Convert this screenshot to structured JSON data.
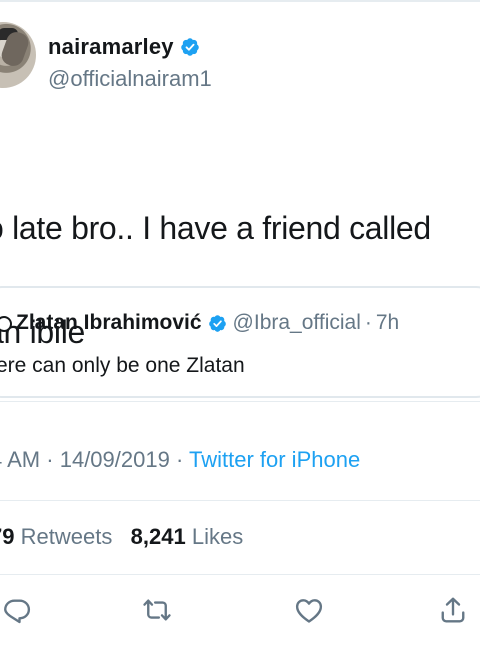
{
  "tweet": {
    "author": {
      "name": "nairamarley",
      "handle": "@officialnairam1"
    },
    "text_line1": "o late bro.. I have a friend called",
    "text_line2": "an ibile",
    "quote": {
      "name": "Zlatan Ibrahimović",
      "handle": "@Ibra_official",
      "separator": "·",
      "time": "7h",
      "text": "ere can only be one Zlatan"
    },
    "meta": {
      "time": "4 AM",
      "separator1": "·",
      "date": "14/09/2019",
      "separator2": "·",
      "source": "Twitter for iPhone"
    },
    "stats": {
      "retweets_count": "79",
      "retweets_label": "Retweets",
      "likes_count": "8,241",
      "likes_label": "Likes"
    }
  },
  "colors": {
    "verified_blue": "#1da1f2",
    "secondary_text": "#657786",
    "primary_text": "#14171a",
    "divider": "#e6ecf0"
  },
  "icons": {
    "reply": "reply-icon",
    "retweet": "retweet-icon",
    "like": "like-icon",
    "share": "share-icon",
    "verified": "verified-badge-icon"
  }
}
